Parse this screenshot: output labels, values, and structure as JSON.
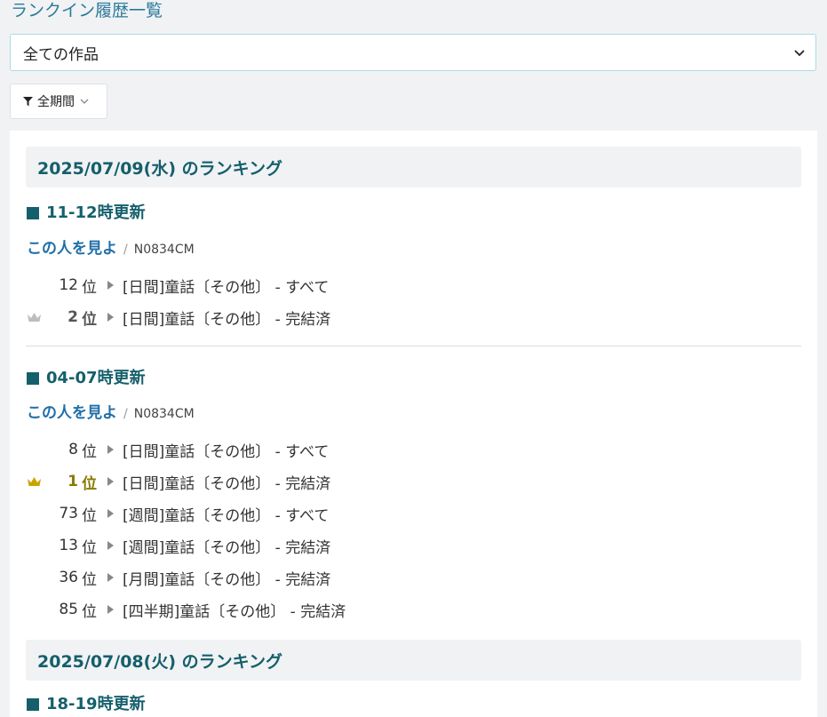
{
  "header": {
    "title": "ランクイン履歴一覧"
  },
  "work_select": {
    "value": "全ての作品"
  },
  "period_filter": {
    "label": "全期間"
  },
  "days": [
    {
      "header": "2025/07/09(水) のランキング",
      "updates": [
        {
          "heading": "11-12時更新",
          "author_link": "この人を見よ",
          "separator": "/",
          "ncode": "N0834CM",
          "rankings": [
            {
              "rank": "12",
              "unit": "位",
              "genre": "[日間]童話〔その他〕 - すべて"
            },
            {
              "rank": "2",
              "unit": "位",
              "genre": "[日間]童話〔その他〕 - 完結済",
              "crown": "silver"
            }
          ]
        },
        {
          "heading": "04-07時更新",
          "author_link": "この人を見よ",
          "separator": "/",
          "ncode": "N0834CM",
          "rankings": [
            {
              "rank": "8",
              "unit": "位",
              "genre": "[日間]童話〔その他〕 - すべて"
            },
            {
              "rank": "1",
              "unit": "位",
              "genre": "[日間]童話〔その他〕 - 完結済",
              "crown": "gold"
            },
            {
              "rank": "73",
              "unit": "位",
              "genre": "[週間]童話〔その他〕 - すべて"
            },
            {
              "rank": "13",
              "unit": "位",
              "genre": "[週間]童話〔その他〕 - 完結済"
            },
            {
              "rank": "36",
              "unit": "位",
              "genre": "[月間]童話〔その他〕 - 完結済"
            },
            {
              "rank": "85",
              "unit": "位",
              "genre": "[四半期]童話〔その他〕 - 完結済"
            }
          ]
        }
      ]
    },
    {
      "header": "2025/07/08(火) のランキング",
      "updates": [
        {
          "heading": "18-19時更新"
        }
      ]
    }
  ],
  "colors": {
    "accent": "#155f6c",
    "link": "#1f6fa8",
    "gold_crown": "#c9a400",
    "silver_crown": "#bdbdbd"
  },
  "icons": {
    "select_arrow": "chevron-down-icon",
    "filter": "filter-icon",
    "crown": "crown-icon",
    "bullet": "play-triangle-icon"
  }
}
